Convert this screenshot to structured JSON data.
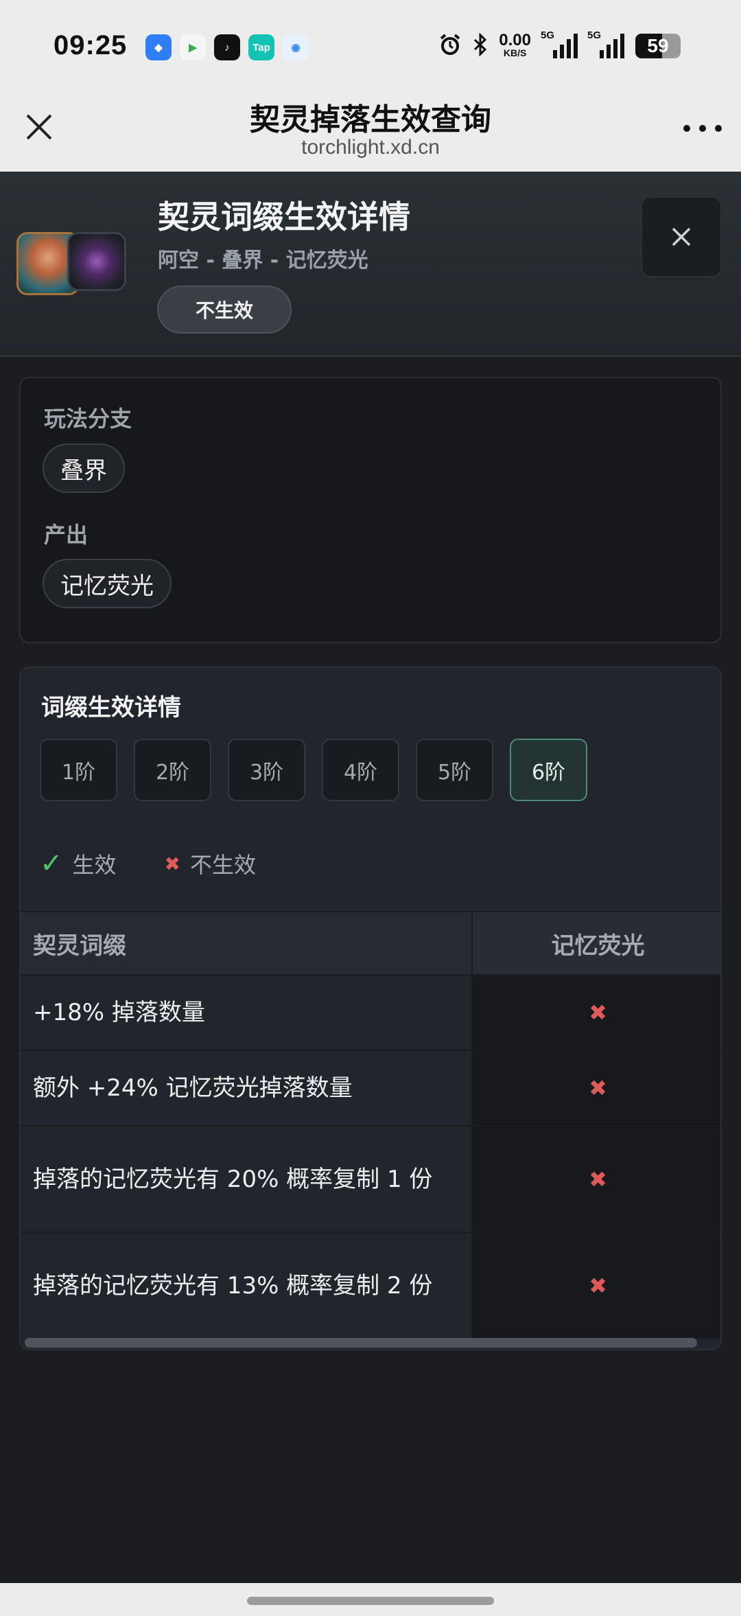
{
  "status_bar": {
    "time": "09:25",
    "net_speed": "0.00",
    "net_unit": "KB/S",
    "sim1": "5G",
    "sim2": "5G",
    "battery": "59",
    "apps": [
      {
        "icon": "blue-bird-app-icon",
        "label": "",
        "color": "#2f7ef6"
      },
      {
        "icon": "video-app-icon",
        "label": "",
        "color": "#f5f5f5"
      },
      {
        "icon": "tiktok-app-icon",
        "label": "",
        "color": "#111111"
      },
      {
        "icon": "taptap-app-icon",
        "label": "Tap",
        "color": "#12c2b3"
      },
      {
        "icon": "browser-app-icon",
        "label": "",
        "color": "#2f8df3"
      }
    ]
  },
  "browser": {
    "title": "契灵掉落生效查询",
    "url": "torchlight.xd.cn"
  },
  "hero": {
    "title": "契灵词缀生效详情",
    "subtitle": "阿空 - 叠界 - 记忆荧光",
    "status": "不生效"
  },
  "info": {
    "branch_label": "玩法分支",
    "branch_value": "叠界",
    "output_label": "产出",
    "output_value": "记忆荧光"
  },
  "details": {
    "title": "词缀生效详情",
    "tiers": [
      "1阶",
      "2阶",
      "3阶",
      "4阶",
      "5阶",
      "6阶"
    ],
    "active_tier": "6阶",
    "legend_active": "生效",
    "legend_inactive": "不生效",
    "columns": [
      "契灵词缀",
      "记忆荧光"
    ],
    "rows": [
      {
        "affix": "+18% 掉落数量",
        "mark": "✖"
      },
      {
        "affix": "额外 +24% 记忆荧光掉落数量",
        "mark": "✖"
      },
      {
        "affix": "掉落的记忆荧光有 20% 概率复制 1 份",
        "mark": "✖"
      },
      {
        "affix": "掉落的记忆荧光有 13% 概率复制 2 份",
        "mark": "✖"
      }
    ]
  }
}
